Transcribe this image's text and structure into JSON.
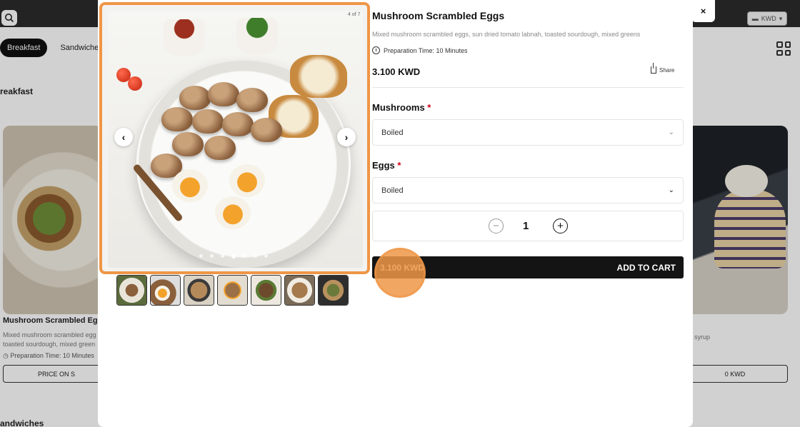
{
  "background": {
    "currency": "KWD",
    "tabs": [
      "Breakfast",
      "Sandwiches"
    ],
    "section_title": "reakfast",
    "section_title2": "andwiches",
    "left_card": {
      "title": "Mushroom Scrambled Eggs",
      "desc": "Mixed mushroom scrambled egg toasted sourdough, mixed green",
      "prep": "Preparation Time: 10 Minutes",
      "button": "PRICE ON S"
    },
    "right_card": {
      "desc": "syrup",
      "desc2": "s",
      "button": "0 KWD"
    }
  },
  "modal": {
    "close": "×",
    "page_count": "4 of 7",
    "title": "Mushroom Scrambled Eggs",
    "description": "Mixed mushroom scrambled eggs, sun dried tomato labnah, toasted sourdough, mixed greens",
    "prep_time": "Preparation Time: 10 Minutes",
    "price": "3.100 KWD",
    "share": "Share",
    "options": [
      {
        "label": "Mushrooms",
        "required": "*",
        "value": "Boiled"
      },
      {
        "label": "Eggs",
        "required": "*",
        "value": "Boiled"
      }
    ],
    "quantity": "1",
    "cart": {
      "price": "3.100 KWD",
      "label": "ADD TO CART"
    },
    "active_slide_index": 3,
    "slide_count": 7
  },
  "colors": {
    "accent": "#ef9647",
    "button_dark": "#141414",
    "required": "#d0021b"
  }
}
